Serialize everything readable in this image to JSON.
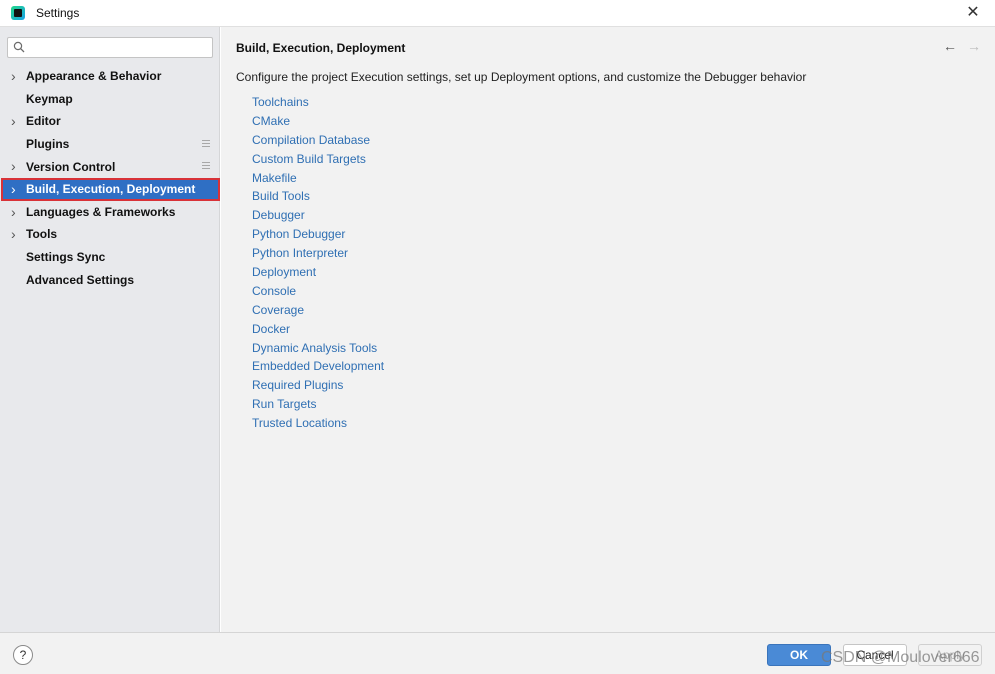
{
  "window": {
    "title": "Settings",
    "close_icon": "close-icon"
  },
  "search": {
    "value": "",
    "placeholder": ""
  },
  "sidebar": {
    "items": [
      {
        "label": "Appearance & Behavior",
        "expandable": true,
        "badge": false,
        "selected": false
      },
      {
        "label": "Keymap",
        "expandable": false,
        "badge": false,
        "selected": false
      },
      {
        "label": "Editor",
        "expandable": true,
        "badge": false,
        "selected": false
      },
      {
        "label": "Plugins",
        "expandable": false,
        "badge": true,
        "selected": false
      },
      {
        "label": "Version Control",
        "expandable": true,
        "badge": true,
        "selected": false
      },
      {
        "label": "Build, Execution, Deployment",
        "expandable": true,
        "badge": false,
        "selected": true
      },
      {
        "label": "Languages & Frameworks",
        "expandable": true,
        "badge": false,
        "selected": false
      },
      {
        "label": "Tools",
        "expandable": true,
        "badge": false,
        "selected": false
      },
      {
        "label": "Settings Sync",
        "expandable": false,
        "badge": false,
        "selected": false
      },
      {
        "label": "Advanced Settings",
        "expandable": false,
        "badge": false,
        "selected": false
      }
    ]
  },
  "main": {
    "title": "Build, Execution, Deployment",
    "description": "Configure the project Execution settings, set up Deployment options, and customize the Debugger behavior",
    "links": [
      "Toolchains",
      "CMake",
      "Compilation Database",
      "Custom Build Targets",
      "Makefile",
      "Build Tools",
      "Debugger",
      "Python Debugger",
      "Python Interpreter",
      "Deployment",
      "Console",
      "Coverage",
      "Docker",
      "Dynamic Analysis Tools",
      "Embedded Development",
      "Required Plugins",
      "Run Targets",
      "Trusted Locations"
    ]
  },
  "footer": {
    "help_label": "?",
    "ok_label": "OK",
    "cancel_label": "Cancel",
    "apply_label": "Apply",
    "watermark": "CSDN @Moulover666"
  },
  "colors": {
    "selection": "#2f6fc4",
    "selection_outline": "#d83238",
    "link": "#2f6fb3",
    "ok_button": "#4a8ad6"
  }
}
